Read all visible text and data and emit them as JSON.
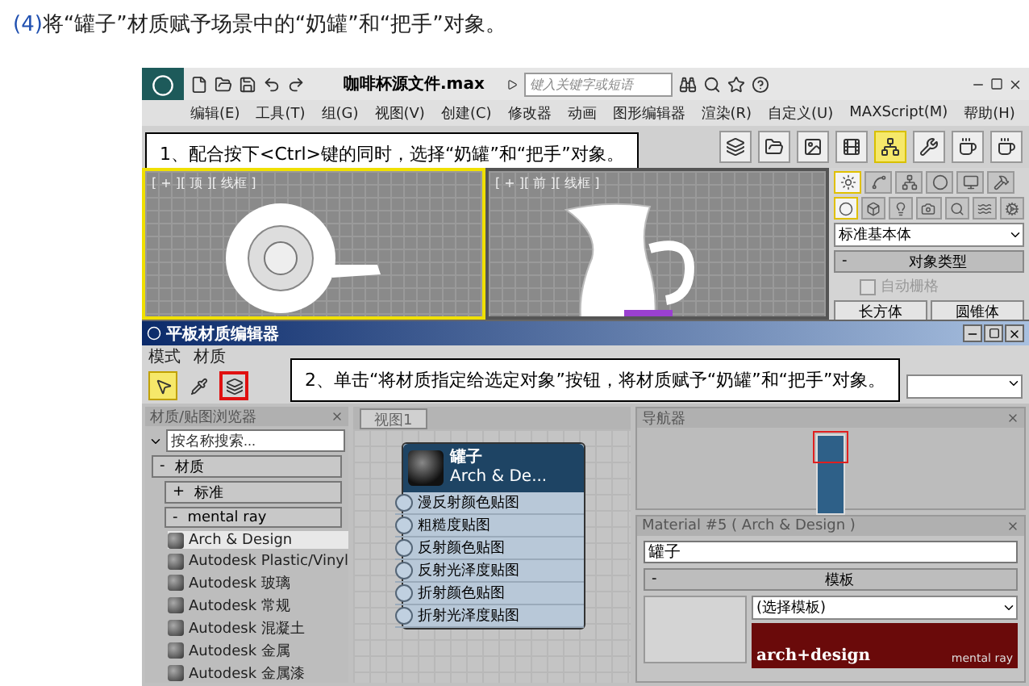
{
  "heading": {
    "step": "(4)",
    "text": "将“罐子”材质赋予场景中的“奶罐”和“把手”对象。"
  },
  "app": {
    "title": "咖啡杯源文件.max",
    "search_placeholder": "键入关键字或短语",
    "menu": [
      "编辑(E)",
      "工具(T)",
      "组(G)",
      "视图(V)",
      "创建(C)",
      "修改器",
      "动画",
      "图形编辑器",
      "渲染(R)",
      "自定义(U)",
      "MAXScript(M)",
      "帮助(H)"
    ],
    "toolbar": [
      {
        "active": false
      },
      {
        "active": false
      },
      {
        "active": false
      },
      {
        "active": false
      },
      {
        "active": true
      },
      {
        "active": false
      },
      {
        "active": false
      },
      {
        "active": false
      }
    ],
    "callout": "1、配合按下<Ctrl>键的同时，选择“奶罐”和“把手”对象。",
    "viewports": [
      {
        "kind": "top",
        "label": "[ + ][ 顶 ][ 线框 ]",
        "active": true
      },
      {
        "kind": "front",
        "label": "[ + ][ 前 ][ 线框 ]",
        "active": false
      }
    ],
    "command_panel": {
      "tabs": [
        {
          "selected": true
        },
        {
          "selected": false
        },
        {
          "selected": false
        },
        {
          "selected": false
        },
        {
          "selected": false
        },
        {
          "selected": false
        }
      ],
      "categories": [
        {
          "selected": true
        },
        {
          "selected": false
        },
        {
          "selected": false
        },
        {
          "selected": false
        },
        {
          "selected": false
        },
        {
          "selected": false
        },
        {
          "selected": false
        }
      ],
      "dropdown": "标准基本体",
      "rollout": {
        "sign": "-",
        "title": "对象类型"
      },
      "autogrid": {
        "label": "自动栅格",
        "checked": false,
        "disabled": true
      },
      "buttons": [
        "长方体",
        "圆锥体"
      ]
    }
  },
  "material_editor": {
    "title": "平板材质编辑器",
    "menu": [
      "模式",
      "材质"
    ],
    "tools": [
      {
        "kind": "select",
        "active": true,
        "highlighted": false
      },
      {
        "kind": "pick",
        "active": false,
        "highlighted": false
      },
      {
        "kind": "assign",
        "active": false,
        "highlighted": true
      }
    ],
    "callout": "2、单击“将材质指定给选定对象”按钮，将材质赋予“奶罐”和“把手”对象。",
    "browser": {
      "title": "材质/贴图浏览器",
      "search_placeholder": "按名称搜索...",
      "groups": [
        {
          "sign": "-",
          "label": "材质",
          "children": [
            {
              "sign": "+",
              "label": "标准"
            },
            {
              "sign": "-",
              "label": "mental ray",
              "children": [
                {
                  "label": "Arch & Design",
                  "selected": true
                },
                {
                  "label": "Autodesk Plastic/Vinyl",
                  "selected": false
                },
                {
                  "label": "Autodesk 玻璃",
                  "selected": false
                },
                {
                  "label": "Autodesk 常规",
                  "selected": false
                },
                {
                  "label": "Autodesk 混凝土",
                  "selected": false
                },
                {
                  "label": "Autodesk 金属",
                  "selected": false
                },
                {
                  "label": "Autodesk 金属漆",
                  "selected": false
                }
              ]
            }
          ]
        }
      ]
    },
    "view_tab": "视图1",
    "node": {
      "title": "罐子",
      "subtitle": "Arch & De...",
      "slots": [
        "漫反射颜色贴图",
        "粗糙度贴图",
        "反射颜色贴图",
        "反射光泽度贴图",
        "折射颜色贴图",
        "折射光泽度贴图"
      ]
    },
    "navigator": {
      "title": "导航器"
    },
    "params": {
      "title": "Material #5 ( Arch & Design )",
      "name": "罐子",
      "rollout": {
        "sign": "-",
        "title": "模板"
      },
      "template": "(选择模板)",
      "banner": {
        "brand": "arch+design",
        "engine": "mental ray"
      }
    }
  }
}
